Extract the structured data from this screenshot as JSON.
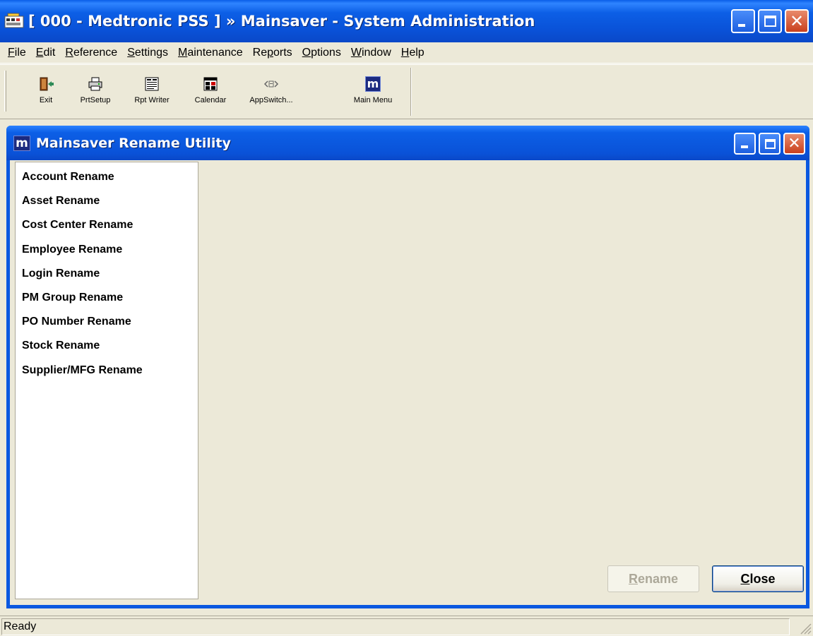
{
  "window": {
    "title": "[ 000 - Medtronic PSS ] » Mainsaver - System Administration",
    "close_glyph": "✕"
  },
  "menu": [
    {
      "pre": "",
      "ul": "F",
      "post": "ile"
    },
    {
      "pre": "",
      "ul": "E",
      "post": "dit"
    },
    {
      "pre": "",
      "ul": "R",
      "post": "eference"
    },
    {
      "pre": "",
      "ul": "S",
      "post": "ettings"
    },
    {
      "pre": "",
      "ul": "M",
      "post": "aintenance"
    },
    {
      "pre": "Re",
      "ul": "p",
      "post": "orts"
    },
    {
      "pre": "",
      "ul": "O",
      "post": "ptions"
    },
    {
      "pre": "",
      "ul": "W",
      "post": "indow"
    },
    {
      "pre": "",
      "ul": "H",
      "post": "elp"
    }
  ],
  "toolbar": {
    "exit": "Exit",
    "prtsetup": "PrtSetup",
    "rptwriter": "Rpt Writer",
    "calendar": "Calendar",
    "appswitch": "AppSwitch...",
    "mainmenu": "Main Menu",
    "mainmenu_glyph": "m"
  },
  "child": {
    "logo": "m",
    "title": "Mainsaver Rename Utility",
    "close_glyph": "✕",
    "items": [
      "Account Rename",
      "Asset Rename",
      "Cost Center Rename",
      "Employee Rename",
      "Login Rename",
      "PM Group Rename",
      "PO Number Rename",
      "Stock Rename",
      "Supplier/MFG Rename"
    ],
    "rename": {
      "ul": "R",
      "post": "ename"
    },
    "close": {
      "ul": "C",
      "post": "lose"
    }
  },
  "status": {
    "text": "Ready"
  },
  "colors": {
    "titlebar": "#0a52d8",
    "face": "#ece9d8",
    "close_button": "#c9401d"
  }
}
